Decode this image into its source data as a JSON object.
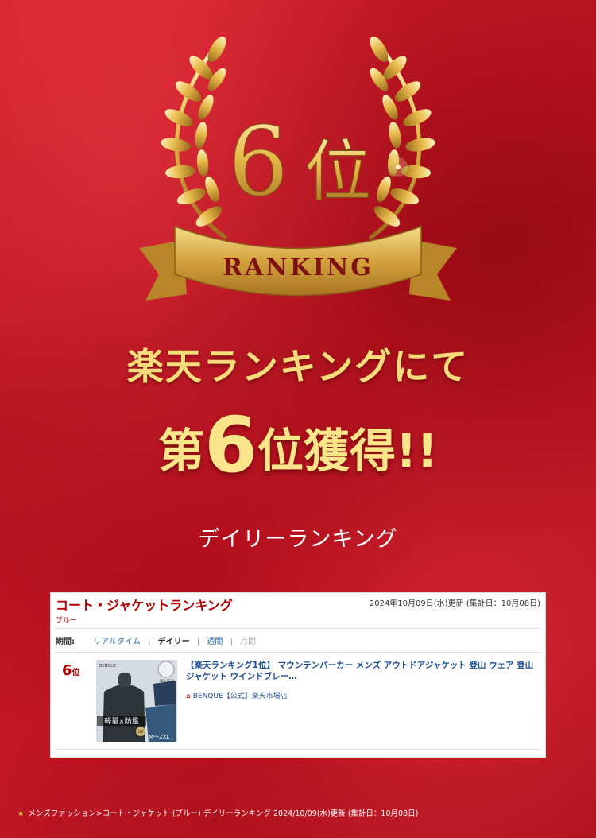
{
  "emblem": {
    "rank_number": "6",
    "rank_suffix": "位",
    "ribbon_text": "RANKING",
    "gold_color": "#e9bd4f",
    "banner_color": "#c9962f"
  },
  "headline": {
    "line1": "楽天ランキングにて",
    "prefix": "第",
    "number": "6",
    "suffix": "位獲得!!"
  },
  "subhead": "デイリーランキング",
  "panel": {
    "title": "コート・ジャケットランキング",
    "date": "2024年10月09日(水)更新 (集計日：10月08日)",
    "color_filter": "ブルー",
    "period_label": "期間:",
    "periods": {
      "realtime": "リアルタイム",
      "daily": "デイリー",
      "weekly": "週間",
      "monthly": "月間",
      "sep": "|"
    },
    "item": {
      "rank": "6",
      "rank_unit": "位",
      "title": "【楽天ランキング1位】 マウンテンパーカー メンズ アウトドアジャケット 登山 ウェア 登山ジャケット ウインドブレー…",
      "shop_icon": "home-icon",
      "shop": "BENQUE【公式】楽天市場店",
      "thumb": {
        "brand": "BENQUE",
        "badge": "DOLLS34",
        "caption": "軽量×防風",
        "size": "M〜2XL",
        "uv": "UV"
      }
    }
  },
  "footer": {
    "star_icon": "star-icon",
    "text": "メンズファッション>コート・ジャケット (ブルー) デイリーランキング 2024/10/09(水)更新 (集計日：10月08日)"
  }
}
